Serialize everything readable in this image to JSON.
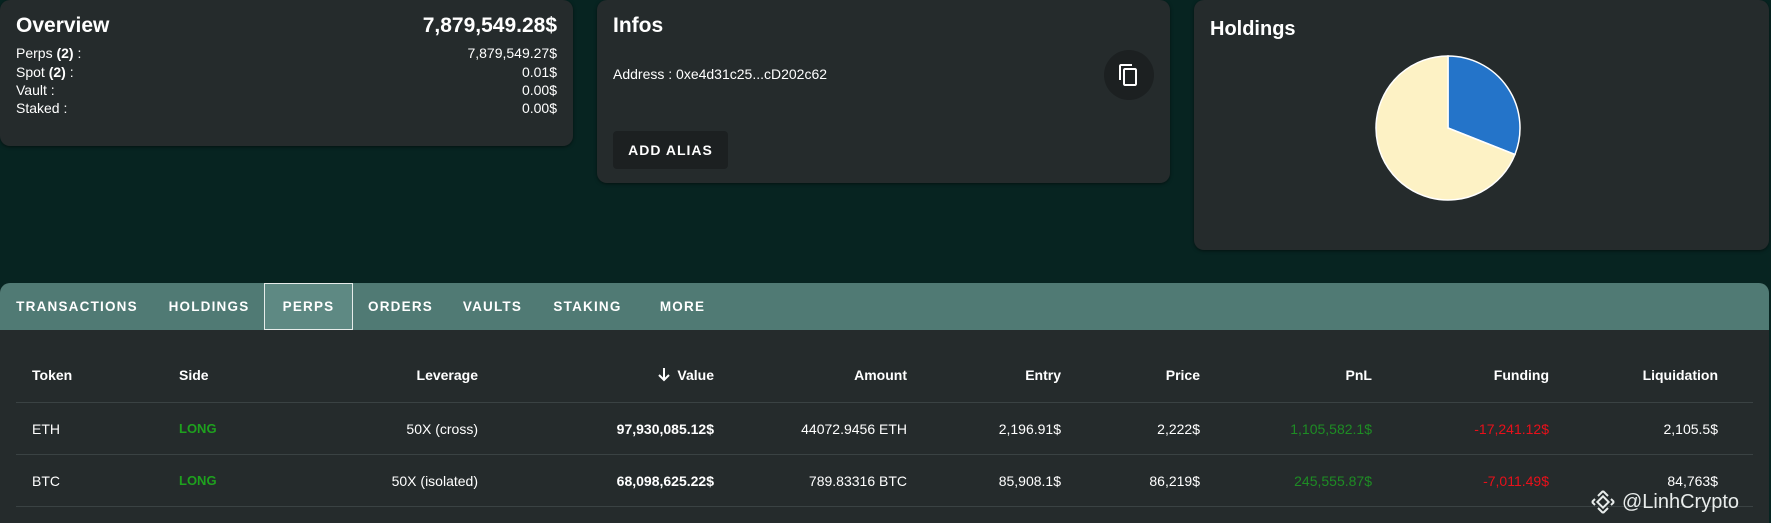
{
  "overview": {
    "title": "Overview",
    "total": "7,879,549.28$",
    "rows": [
      {
        "label": "Perps",
        "count": "(2)",
        "suffix": " :",
        "value": "7,879,549.27$"
      },
      {
        "label": "Spot",
        "count": "(2)",
        "suffix": " :",
        "value": "0.01$"
      },
      {
        "label": "Vault :",
        "count": "",
        "suffix": "",
        "value": "0.00$"
      },
      {
        "label": "Staked :",
        "count": "",
        "suffix": "",
        "value": "0.00$"
      }
    ]
  },
  "infos": {
    "title": "Infos",
    "address": "Address : 0xe4d31c25...cD202c62",
    "copy_icon": "copy-icon",
    "alias_button": "ADD ALIAS"
  },
  "holdings": {
    "title": "Holdings",
    "slices": [
      {
        "fraction": 0.31,
        "color": "#2474c9"
      },
      {
        "fraction": 0.69,
        "color": "#fdf2c5"
      }
    ]
  },
  "tabs": [
    {
      "label": "TRANSACTIONS",
      "active": false
    },
    {
      "label": "HOLDINGS",
      "active": false
    },
    {
      "label": "PERPS",
      "active": true
    },
    {
      "label": "ORDERS",
      "active": false
    },
    {
      "label": "VAULTS",
      "active": false
    },
    {
      "label": "STAKING",
      "active": false
    },
    {
      "label": "MORE",
      "active": false
    }
  ],
  "table": {
    "columns": [
      "Token",
      "Side",
      "Leverage",
      "Value",
      "Amount",
      "Entry",
      "Price",
      "PnL",
      "Funding",
      "Liquidation"
    ],
    "sort_icon": "arrow-down-icon",
    "rows": [
      {
        "token": "ETH",
        "side": "LONG",
        "leverage": "50X (cross)",
        "value": "97,930,085.12$",
        "amount": "44072.9456 ETH",
        "entry": "2,196.91$",
        "price": "2,222$",
        "pnl": "1,105,582.1$",
        "funding": "-17,241.12$",
        "liquidation": "2,105.5$"
      },
      {
        "token": "BTC",
        "side": "LONG",
        "leverage": "50X (isolated)",
        "value": "68,098,625.22$",
        "amount": "789.83316 BTC",
        "entry": "85,908.1$",
        "price": "86,219$",
        "pnl": "245,555.87$",
        "funding": "-7,011.49$",
        "liquidation": "84,763$"
      }
    ]
  },
  "watermark": {
    "text": "@LinhCrypto",
    "icon": "binance-logo-icon"
  },
  "colors": {
    "background": "#072421",
    "card": "#252b2c",
    "tabbar": "#507a74",
    "long": "#1ea11e",
    "pnl_positive": "#1e8c24",
    "funding_negative": "#e8101a"
  }
}
